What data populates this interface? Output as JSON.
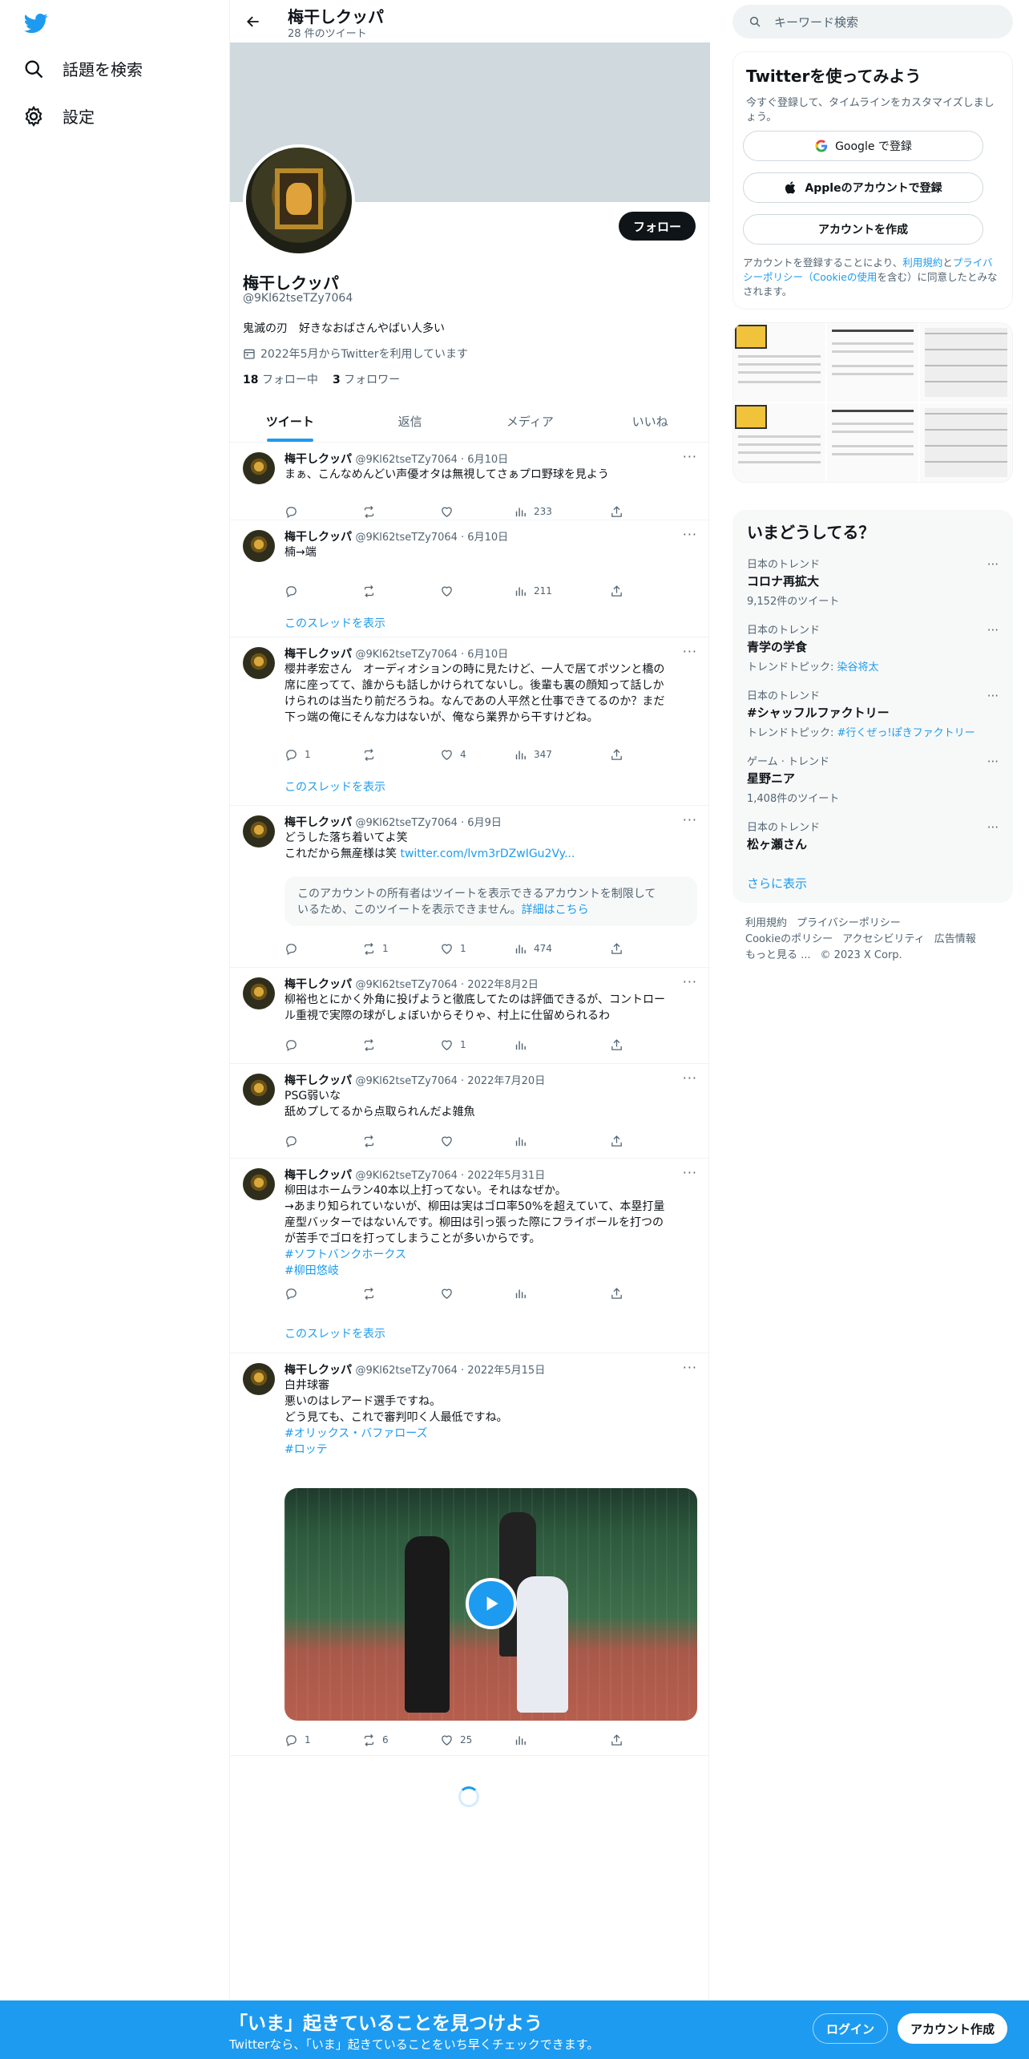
{
  "nav": {
    "explore_label": "話題を検索",
    "settings_label": "設定"
  },
  "header": {
    "name": "梅干しクッパ",
    "tweet_count": "28 件のツイート"
  },
  "profile": {
    "follow_label": "フォロー",
    "name": "梅干しクッパ",
    "handle": "@9Kl62tseTZy7064",
    "bio": "鬼滅の刃　好きなおばさんやばい人多い",
    "joined": "2022年5月からTwitterを利用しています",
    "following_count": "18",
    "following_label": "フォロー中",
    "followers_count": "3",
    "followers_label": "フォロワー"
  },
  "tabs": [
    "ツイート",
    "返信",
    "メディア",
    "いいね"
  ],
  "thread_link": "このスレッドを表示",
  "tweets": [
    {
      "name": "梅干しクッパ",
      "meta": "@9Kl62tseTZy7064 · 6月10日",
      "text": "まぁ、こんなめんどい声優オタは無視してさぁプロ野球を見よう",
      "reply": "",
      "retweet": "",
      "like": "",
      "views": "233"
    },
    {
      "name": "梅干しクッパ",
      "meta": "@9Kl62tseTZy7064 · 6月10日",
      "text": "楠→端",
      "reply": "",
      "retweet": "",
      "like": "",
      "views": "211"
    },
    {
      "name": "梅干しクッパ",
      "meta": "@9Kl62tseTZy7064 · 6月10日",
      "text": "櫻井孝宏さん　オーディオションの時に見たけど、一人で居てポツンと橋の\n席に座ってて、誰からも話しかけられてないし。後輩も裏の顔知って話しか\nけられのは当たり前だろうね。なんであの人平然と仕事できてるのか？まだ\n下っ端の俺にそんな力はないが、俺なら業界から干すけどね。",
      "reply": "1",
      "retweet": "",
      "like": "4",
      "views": "347"
    },
    {
      "name": "梅干しクッパ",
      "meta": "@9Kl62tseTZy7064 · 6月9日",
      "text": "どうした落ち着いてよ笑\nこれだから無産様は笑 ",
      "link": "twitter.com/lvm3rDZwIGu2Vy...",
      "restricted": "このアカウントの所有者はツイートを表示できるアカウントを制限して\nいるため、このツイートを表示できません。",
      "restricted_link": "詳細はこちら",
      "reply": "",
      "retweet": "1",
      "like": "1",
      "views": "474"
    },
    {
      "name": "梅干しクッパ",
      "meta": "@9Kl62tseTZy7064 · 2022年8月2日",
      "text": "柳裕也とにかく外角に投げようと徹底してたのは評価できるが、コントロー\nル重視で実際の球がしょぼいからそりゃ、村上に仕留められるわ",
      "reply": "",
      "retweet": "",
      "like": "1",
      "views": ""
    },
    {
      "name": "梅干しクッパ",
      "meta": "@9Kl62tseTZy7064 · 2022年7月20日",
      "text": "PSG弱いな\n舐めプしてるから点取られんだよ雑魚",
      "reply": "",
      "retweet": "",
      "like": "",
      "views": ""
    },
    {
      "name": "梅干しクッパ",
      "meta": "@9Kl62tseTZy7064 · 2022年5月31日",
      "text": "柳田はホームラン40本以上打ってない。それはなぜか。\n→あまり知られていないが、柳田は実はゴロ率50%を超えていて、本塁打量\n産型バッターではないんです。柳田は引っ張った際にフライボールを打つの\nが苦手でゴロを打ってしまうことが多いからです。",
      "hashtags": [
        "#ソフトバンクホークス",
        "#柳田悠岐"
      ],
      "reply": "",
      "retweet": "",
      "like": "",
      "views": ""
    },
    {
      "name": "梅干しクッパ",
      "meta": "@9Kl62tseTZy7064 · 2022年5月15日",
      "text": "白井球審\n悪いのはレアード選手ですね。\nどう見ても、これで審判叩く人最低ですね。\n",
      "hashtags": [
        "#オリックス・バファローズ",
        "#ロッテ"
      ],
      "reply": "1",
      "retweet": "6",
      "like": "25",
      "views": ""
    }
  ],
  "search": {
    "placeholder": "キーワード検索"
  },
  "signup": {
    "title": "Twitterを使ってみよう",
    "subtitle": "今すぐ登録して、タイムラインをカスタマイズしましょう。",
    "google": "Google で登録",
    "apple": "Appleのアカウントで登録",
    "create": "アカウントを作成",
    "terms_1": "アカウントを登録することにより、",
    "terms_link1": "利用規約",
    "terms_2": "と",
    "terms_link2": "プライバシーポリシー（Cookieの使用",
    "terms_3": "を含む）に同意したとみなされます。"
  },
  "trends": {
    "title": "いまどうしてる？",
    "items": [
      {
        "context": "日本のトレンド",
        "name": "コロナ再拡大",
        "extra": "9,152件のツイート",
        "extra_link": ""
      },
      {
        "context": "日本のトレンド",
        "name": "青学の学食",
        "extra": "トレンドトピック: ",
        "extra_link": "染谷将太"
      },
      {
        "context": "日本のトレンド",
        "name": "#シャッフルファクトリー",
        "extra": "トレンドトピック: ",
        "extra_link": "#行くぜっ!ぽきファクトリー"
      },
      {
        "context": "ゲーム · トレンド",
        "name": "星野ニア",
        "extra": "1,408件のツイート",
        "extra_link": ""
      },
      {
        "context": "日本のトレンド",
        "name": "松ヶ瀬さん",
        "extra": "",
        "extra_link": ""
      }
    ],
    "show_more": "さらに表示"
  },
  "footer": {
    "line1": [
      "利用規約",
      "プライバシーポリシー"
    ],
    "line2": [
      "Cookieのポリシー",
      "アクセシビリティ",
      "広告情報"
    ],
    "line3": [
      "もっと見る ...",
      "© 2023 X Corp."
    ]
  },
  "bottombar": {
    "title": "「いま」起きていることを見つけよう",
    "subtitle": "Twitterなら、「いま」起きていることをいち早くチェックできます。",
    "login": "ログイン",
    "signup": "アカウント作成"
  },
  "colors": {
    "accent": "#1d9bf0",
    "text": "#0f1419",
    "muted": "#536471"
  }
}
